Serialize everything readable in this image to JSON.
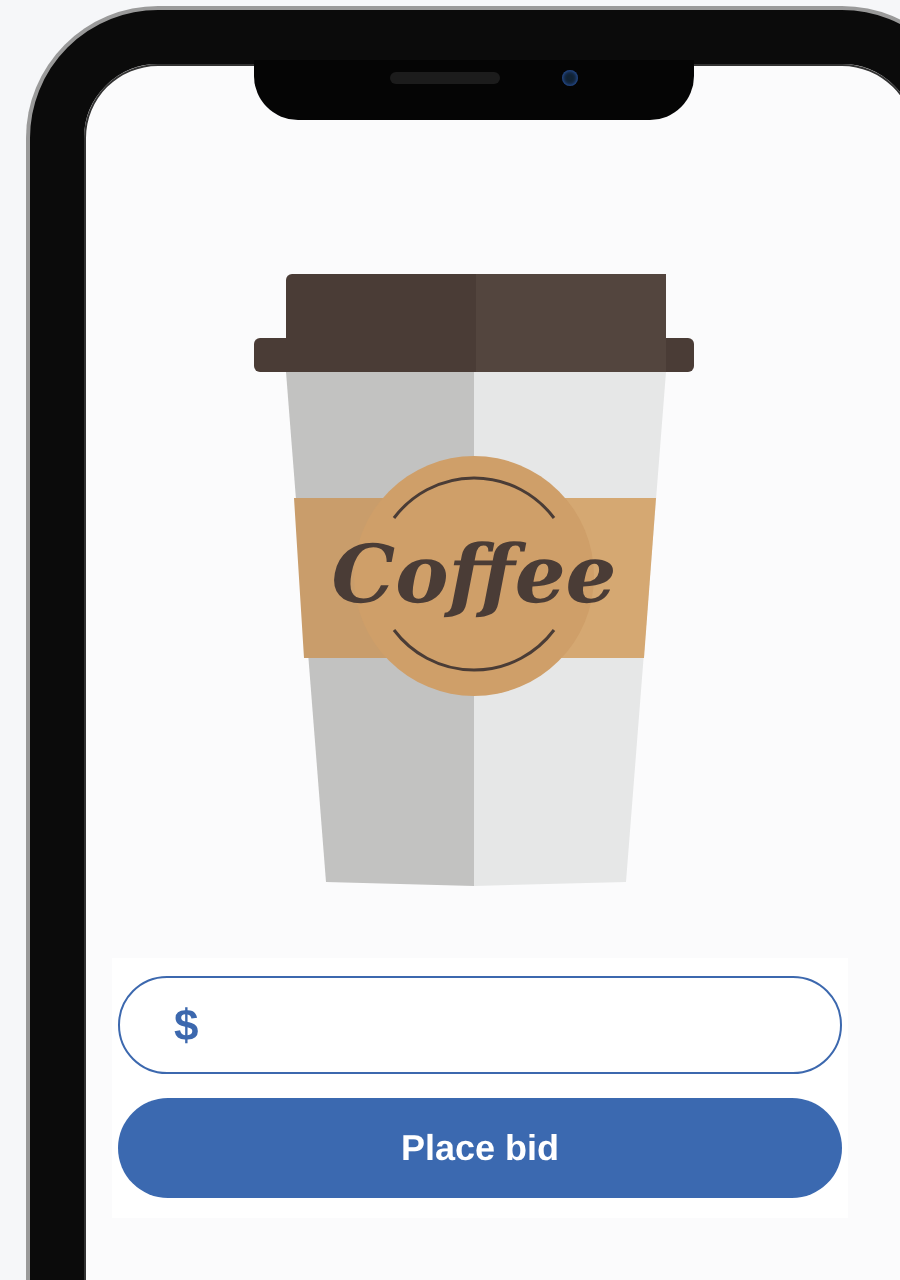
{
  "illustration": {
    "label": "Coffee"
  },
  "bid_field": {
    "prefix": "$"
  },
  "submit_button": {
    "label": "Place bid"
  }
}
